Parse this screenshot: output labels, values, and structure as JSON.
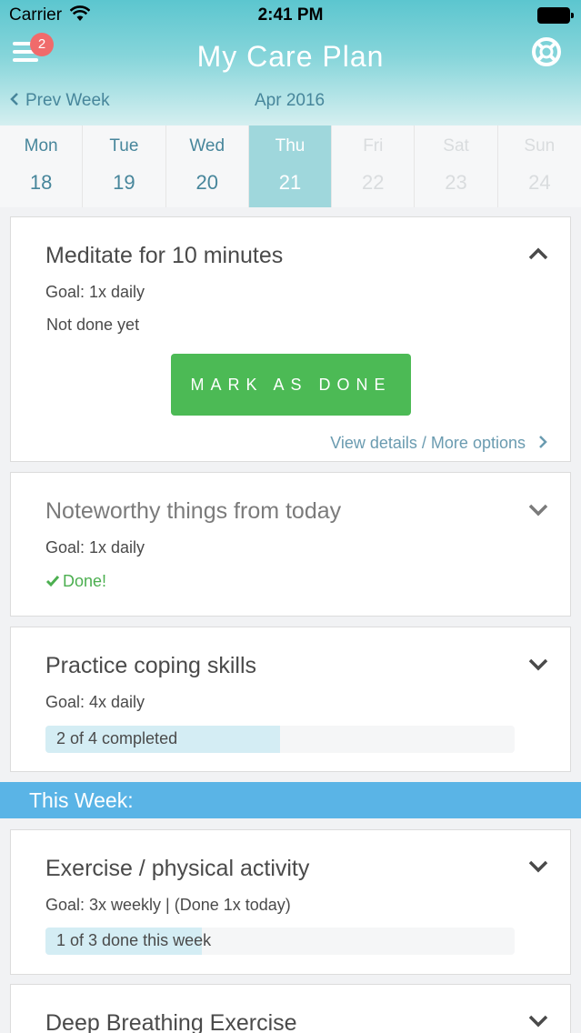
{
  "status_bar": {
    "carrier": "Carrier",
    "time": "2:41 PM"
  },
  "header": {
    "title": "My Care Plan",
    "menu_badge": "2",
    "prev_week": "Prev Week",
    "month": "Apr 2016"
  },
  "days": [
    {
      "name": "Mon",
      "num": "18",
      "state": "past"
    },
    {
      "name": "Tue",
      "num": "19",
      "state": "past"
    },
    {
      "name": "Wed",
      "num": "20",
      "state": "past"
    },
    {
      "name": "Thu",
      "num": "21",
      "state": "selected"
    },
    {
      "name": "Fri",
      "num": "22",
      "state": "future"
    },
    {
      "name": "Sat",
      "num": "23",
      "state": "future"
    },
    {
      "name": "Sun",
      "num": "24",
      "state": "future"
    }
  ],
  "cards": {
    "meditate": {
      "title": "Meditate for 10 minutes",
      "goal": "Goal: 1x daily",
      "status": "Not done yet",
      "button": "MARK AS DONE",
      "details": "View details / More options"
    },
    "noteworthy": {
      "title": "Noteworthy things from today",
      "goal": "Goal: 1x daily",
      "status": "Done!"
    },
    "coping": {
      "title": "Practice coping skills",
      "goal": "Goal: 4x daily",
      "progress_text": "2 of 4 completed",
      "progress": 0.5
    }
  },
  "this_week": {
    "header": "This Week:",
    "exercise": {
      "title": "Exercise / physical activity",
      "goal": "Goal: 3x weekly | (Done 1x today)",
      "progress_text": "1 of 3 done this week",
      "progress": 0.333
    },
    "breathing": {
      "title": "Deep Breathing Exercise"
    }
  },
  "colors": {
    "accent_green": "#4cba55",
    "week_header": "#5ab4e6",
    "badge": "#f06b6b",
    "link": "#47869b"
  }
}
